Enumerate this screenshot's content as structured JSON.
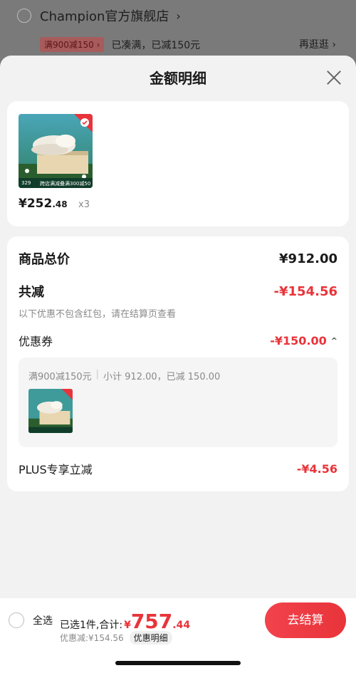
{
  "background": {
    "shop_name": "Champion官方旗舰店",
    "promo_tag": "满900减150 ›",
    "promo_status": "已凑满，已减150元",
    "browse_more": "再逛逛 ›"
  },
  "sheet": {
    "title": "金额明细"
  },
  "product": {
    "price_int": "¥252",
    "price_dec": ".48",
    "quantity": "x3",
    "image_badge": "跨店满减叠满300减50",
    "image_corner": "329"
  },
  "summary": {
    "total_label": "商品总价",
    "total_value": "¥912.00",
    "discount_label": "共减",
    "discount_value": "-¥154.56",
    "note": "以下优惠不包含红包，请在结算页查看",
    "coupon_label": "优惠券",
    "coupon_value": "-¥150.00",
    "coupon_rule": "满900减150元",
    "coupon_detail": "小计 912.00，已减 150.00",
    "plus_label": "PLUS专享立减",
    "plus_value": "-¥4.56"
  },
  "bottom": {
    "select_all": "全选",
    "selected_info": "已选1件,合计:",
    "yen": "¥",
    "total_int": "757",
    "total_dec": ".44",
    "discount_text": "优惠减:¥154.56",
    "detail_button": "优惠明细",
    "checkout_button": "去结算"
  },
  "colors": {
    "accent_red": "#e8343a",
    "overlay": "#6e6e6e"
  }
}
